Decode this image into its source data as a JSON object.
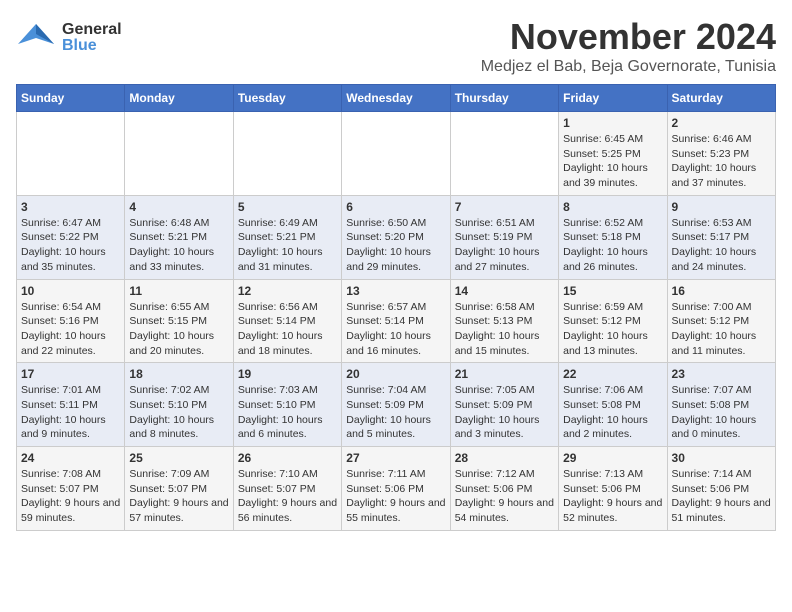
{
  "header": {
    "logo_general": "General",
    "logo_blue": "Blue",
    "month_title": "November 2024",
    "location": "Medjez el Bab, Beja Governorate, Tunisia"
  },
  "days_of_week": [
    "Sunday",
    "Monday",
    "Tuesday",
    "Wednesday",
    "Thursday",
    "Friday",
    "Saturday"
  ],
  "weeks": [
    [
      {
        "day": "",
        "info": ""
      },
      {
        "day": "",
        "info": ""
      },
      {
        "day": "",
        "info": ""
      },
      {
        "day": "",
        "info": ""
      },
      {
        "day": "",
        "info": ""
      },
      {
        "day": "1",
        "info": "Sunrise: 6:45 AM\nSunset: 5:25 PM\nDaylight: 10 hours and 39 minutes."
      },
      {
        "day": "2",
        "info": "Sunrise: 6:46 AM\nSunset: 5:23 PM\nDaylight: 10 hours and 37 minutes."
      }
    ],
    [
      {
        "day": "3",
        "info": "Sunrise: 6:47 AM\nSunset: 5:22 PM\nDaylight: 10 hours and 35 minutes."
      },
      {
        "day": "4",
        "info": "Sunrise: 6:48 AM\nSunset: 5:21 PM\nDaylight: 10 hours and 33 minutes."
      },
      {
        "day": "5",
        "info": "Sunrise: 6:49 AM\nSunset: 5:21 PM\nDaylight: 10 hours and 31 minutes."
      },
      {
        "day": "6",
        "info": "Sunrise: 6:50 AM\nSunset: 5:20 PM\nDaylight: 10 hours and 29 minutes."
      },
      {
        "day": "7",
        "info": "Sunrise: 6:51 AM\nSunset: 5:19 PM\nDaylight: 10 hours and 27 minutes."
      },
      {
        "day": "8",
        "info": "Sunrise: 6:52 AM\nSunset: 5:18 PM\nDaylight: 10 hours and 26 minutes."
      },
      {
        "day": "9",
        "info": "Sunrise: 6:53 AM\nSunset: 5:17 PM\nDaylight: 10 hours and 24 minutes."
      }
    ],
    [
      {
        "day": "10",
        "info": "Sunrise: 6:54 AM\nSunset: 5:16 PM\nDaylight: 10 hours and 22 minutes."
      },
      {
        "day": "11",
        "info": "Sunrise: 6:55 AM\nSunset: 5:15 PM\nDaylight: 10 hours and 20 minutes."
      },
      {
        "day": "12",
        "info": "Sunrise: 6:56 AM\nSunset: 5:14 PM\nDaylight: 10 hours and 18 minutes."
      },
      {
        "day": "13",
        "info": "Sunrise: 6:57 AM\nSunset: 5:14 PM\nDaylight: 10 hours and 16 minutes."
      },
      {
        "day": "14",
        "info": "Sunrise: 6:58 AM\nSunset: 5:13 PM\nDaylight: 10 hours and 15 minutes."
      },
      {
        "day": "15",
        "info": "Sunrise: 6:59 AM\nSunset: 5:12 PM\nDaylight: 10 hours and 13 minutes."
      },
      {
        "day": "16",
        "info": "Sunrise: 7:00 AM\nSunset: 5:12 PM\nDaylight: 10 hours and 11 minutes."
      }
    ],
    [
      {
        "day": "17",
        "info": "Sunrise: 7:01 AM\nSunset: 5:11 PM\nDaylight: 10 hours and 9 minutes."
      },
      {
        "day": "18",
        "info": "Sunrise: 7:02 AM\nSunset: 5:10 PM\nDaylight: 10 hours and 8 minutes."
      },
      {
        "day": "19",
        "info": "Sunrise: 7:03 AM\nSunset: 5:10 PM\nDaylight: 10 hours and 6 minutes."
      },
      {
        "day": "20",
        "info": "Sunrise: 7:04 AM\nSunset: 5:09 PM\nDaylight: 10 hours and 5 minutes."
      },
      {
        "day": "21",
        "info": "Sunrise: 7:05 AM\nSunset: 5:09 PM\nDaylight: 10 hours and 3 minutes."
      },
      {
        "day": "22",
        "info": "Sunrise: 7:06 AM\nSunset: 5:08 PM\nDaylight: 10 hours and 2 minutes."
      },
      {
        "day": "23",
        "info": "Sunrise: 7:07 AM\nSunset: 5:08 PM\nDaylight: 10 hours and 0 minutes."
      }
    ],
    [
      {
        "day": "24",
        "info": "Sunrise: 7:08 AM\nSunset: 5:07 PM\nDaylight: 9 hours and 59 minutes."
      },
      {
        "day": "25",
        "info": "Sunrise: 7:09 AM\nSunset: 5:07 PM\nDaylight: 9 hours and 57 minutes."
      },
      {
        "day": "26",
        "info": "Sunrise: 7:10 AM\nSunset: 5:07 PM\nDaylight: 9 hours and 56 minutes."
      },
      {
        "day": "27",
        "info": "Sunrise: 7:11 AM\nSunset: 5:06 PM\nDaylight: 9 hours and 55 minutes."
      },
      {
        "day": "28",
        "info": "Sunrise: 7:12 AM\nSunset: 5:06 PM\nDaylight: 9 hours and 54 minutes."
      },
      {
        "day": "29",
        "info": "Sunrise: 7:13 AM\nSunset: 5:06 PM\nDaylight: 9 hours and 52 minutes."
      },
      {
        "day": "30",
        "info": "Sunrise: 7:14 AM\nSunset: 5:06 PM\nDaylight: 9 hours and 51 minutes."
      }
    ]
  ]
}
